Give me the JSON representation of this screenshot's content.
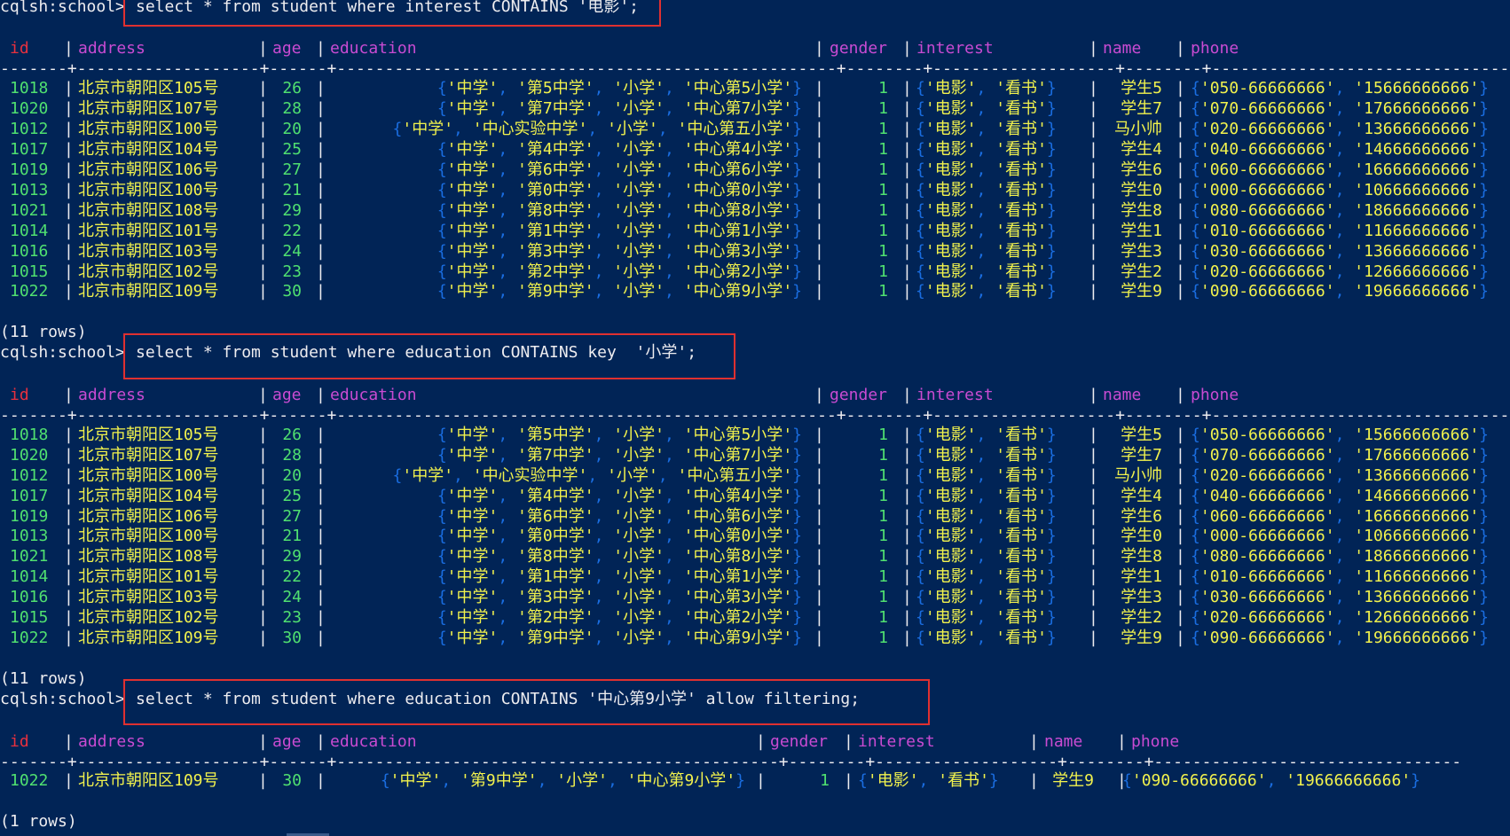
{
  "prompt": "cqlsh:school>",
  "blocks": [
    {
      "command": "select * from student where interest CONTAINS '电影';",
      "rows_summary": "(11 rows)",
      "columns": [
        "id",
        "address",
        "age",
        "education",
        "gender",
        "interest",
        "name",
        "phone"
      ],
      "rows": [
        {
          "id": "1018",
          "address": "北京市朝阳区105号",
          "age": "26",
          "education": [
            "中学",
            "第5中学",
            "小学",
            "中心第5小学"
          ],
          "gender": "1",
          "interest": [
            "电影",
            "看书"
          ],
          "name": "学生5",
          "phone": [
            "050-66666666",
            "15666666666"
          ]
        },
        {
          "id": "1020",
          "address": "北京市朝阳区107号",
          "age": "28",
          "education": [
            "中学",
            "第7中学",
            "小学",
            "中心第7小学"
          ],
          "gender": "1",
          "interest": [
            "电影",
            "看书"
          ],
          "name": "学生7",
          "phone": [
            "070-66666666",
            "17666666666"
          ]
        },
        {
          "id": "1012",
          "address": "北京市朝阳区100号",
          "age": "20",
          "education": [
            "中学",
            "中心实验中学",
            "小学",
            "中心第五小学"
          ],
          "gender": "1",
          "interest": [
            "电影",
            "看书"
          ],
          "name": "马小帅",
          "phone": [
            "020-66666666",
            "13666666666"
          ]
        },
        {
          "id": "1017",
          "address": "北京市朝阳区104号",
          "age": "25",
          "education": [
            "中学",
            "第4中学",
            "小学",
            "中心第4小学"
          ],
          "gender": "1",
          "interest": [
            "电影",
            "看书"
          ],
          "name": "学生4",
          "phone": [
            "040-66666666",
            "14666666666"
          ]
        },
        {
          "id": "1019",
          "address": "北京市朝阳区106号",
          "age": "27",
          "education": [
            "中学",
            "第6中学",
            "小学",
            "中心第6小学"
          ],
          "gender": "1",
          "interest": [
            "电影",
            "看书"
          ],
          "name": "学生6",
          "phone": [
            "060-66666666",
            "16666666666"
          ]
        },
        {
          "id": "1013",
          "address": "北京市朝阳区100号",
          "age": "21",
          "education": [
            "中学",
            "第0中学",
            "小学",
            "中心第0小学"
          ],
          "gender": "1",
          "interest": [
            "电影",
            "看书"
          ],
          "name": "学生0",
          "phone": [
            "000-66666666",
            "10666666666"
          ]
        },
        {
          "id": "1021",
          "address": "北京市朝阳区108号",
          "age": "29",
          "education": [
            "中学",
            "第8中学",
            "小学",
            "中心第8小学"
          ],
          "gender": "1",
          "interest": [
            "电影",
            "看书"
          ],
          "name": "学生8",
          "phone": [
            "080-66666666",
            "18666666666"
          ]
        },
        {
          "id": "1014",
          "address": "北京市朝阳区101号",
          "age": "22",
          "education": [
            "中学",
            "第1中学",
            "小学",
            "中心第1小学"
          ],
          "gender": "1",
          "interest": [
            "电影",
            "看书"
          ],
          "name": "学生1",
          "phone": [
            "010-66666666",
            "11666666666"
          ]
        },
        {
          "id": "1016",
          "address": "北京市朝阳区103号",
          "age": "24",
          "education": [
            "中学",
            "第3中学",
            "小学",
            "中心第3小学"
          ],
          "gender": "1",
          "interest": [
            "电影",
            "看书"
          ],
          "name": "学生3",
          "phone": [
            "030-66666666",
            "13666666666"
          ]
        },
        {
          "id": "1015",
          "address": "北京市朝阳区102号",
          "age": "23",
          "education": [
            "中学",
            "第2中学",
            "小学",
            "中心第2小学"
          ],
          "gender": "1",
          "interest": [
            "电影",
            "看书"
          ],
          "name": "学生2",
          "phone": [
            "020-66666666",
            "12666666666"
          ]
        },
        {
          "id": "1022",
          "address": "北京市朝阳区109号",
          "age": "30",
          "education": [
            "中学",
            "第9中学",
            "小学",
            "中心第9小学"
          ],
          "gender": "1",
          "interest": [
            "电影",
            "看书"
          ],
          "name": "学生9",
          "phone": [
            "090-66666666",
            "19666666666"
          ]
        }
      ]
    },
    {
      "command": "select * from student where education CONTAINS key  '小学';",
      "rows_summary": "(11 rows)",
      "columns": [
        "id",
        "address",
        "age",
        "education",
        "gender",
        "interest",
        "name",
        "phone"
      ],
      "rows": [
        {
          "id": "1018",
          "address": "北京市朝阳区105号",
          "age": "26",
          "education": [
            "中学",
            "第5中学",
            "小学",
            "中心第5小学"
          ],
          "gender": "1",
          "interest": [
            "电影",
            "看书"
          ],
          "name": "学生5",
          "phone": [
            "050-66666666",
            "15666666666"
          ]
        },
        {
          "id": "1020",
          "address": "北京市朝阳区107号",
          "age": "28",
          "education": [
            "中学",
            "第7中学",
            "小学",
            "中心第7小学"
          ],
          "gender": "1",
          "interest": [
            "电影",
            "看书"
          ],
          "name": "学生7",
          "phone": [
            "070-66666666",
            "17666666666"
          ]
        },
        {
          "id": "1012",
          "address": "北京市朝阳区100号",
          "age": "20",
          "education": [
            "中学",
            "中心实验中学",
            "小学",
            "中心第五小学"
          ],
          "gender": "1",
          "interest": [
            "电影",
            "看书"
          ],
          "name": "马小帅",
          "phone": [
            "020-66666666",
            "13666666666"
          ]
        },
        {
          "id": "1017",
          "address": "北京市朝阳区104号",
          "age": "25",
          "education": [
            "中学",
            "第4中学",
            "小学",
            "中心第4小学"
          ],
          "gender": "1",
          "interest": [
            "电影",
            "看书"
          ],
          "name": "学生4",
          "phone": [
            "040-66666666",
            "14666666666"
          ]
        },
        {
          "id": "1019",
          "address": "北京市朝阳区106号",
          "age": "27",
          "education": [
            "中学",
            "第6中学",
            "小学",
            "中心第6小学"
          ],
          "gender": "1",
          "interest": [
            "电影",
            "看书"
          ],
          "name": "学生6",
          "phone": [
            "060-66666666",
            "16666666666"
          ]
        },
        {
          "id": "1013",
          "address": "北京市朝阳区100号",
          "age": "21",
          "education": [
            "中学",
            "第0中学",
            "小学",
            "中心第0小学"
          ],
          "gender": "1",
          "interest": [
            "电影",
            "看书"
          ],
          "name": "学生0",
          "phone": [
            "000-66666666",
            "10666666666"
          ]
        },
        {
          "id": "1021",
          "address": "北京市朝阳区108号",
          "age": "29",
          "education": [
            "中学",
            "第8中学",
            "小学",
            "中心第8小学"
          ],
          "gender": "1",
          "interest": [
            "电影",
            "看书"
          ],
          "name": "学生8",
          "phone": [
            "080-66666666",
            "18666666666"
          ]
        },
        {
          "id": "1014",
          "address": "北京市朝阳区101号",
          "age": "22",
          "education": [
            "中学",
            "第1中学",
            "小学",
            "中心第1小学"
          ],
          "gender": "1",
          "interest": [
            "电影",
            "看书"
          ],
          "name": "学生1",
          "phone": [
            "010-66666666",
            "11666666666"
          ]
        },
        {
          "id": "1016",
          "address": "北京市朝阳区103号",
          "age": "24",
          "education": [
            "中学",
            "第3中学",
            "小学",
            "中心第3小学"
          ],
          "gender": "1",
          "interest": [
            "电影",
            "看书"
          ],
          "name": "学生3",
          "phone": [
            "030-66666666",
            "13666666666"
          ]
        },
        {
          "id": "1015",
          "address": "北京市朝阳区102号",
          "age": "23",
          "education": [
            "中学",
            "第2中学",
            "小学",
            "中心第2小学"
          ],
          "gender": "1",
          "interest": [
            "电影",
            "看书"
          ],
          "name": "学生2",
          "phone": [
            "020-66666666",
            "12666666666"
          ]
        },
        {
          "id": "1022",
          "address": "北京市朝阳区109号",
          "age": "30",
          "education": [
            "中学",
            "第9中学",
            "小学",
            "中心第9小学"
          ],
          "gender": "1",
          "interest": [
            "电影",
            "看书"
          ],
          "name": "学生9",
          "phone": [
            "090-66666666",
            "19666666666"
          ]
        }
      ]
    },
    {
      "command": "select * from student where education CONTAINS '中心第9小学' allow filtering;",
      "rows_summary": "(1 rows)",
      "columns": [
        "id",
        "address",
        "age",
        "education",
        "gender",
        "interest",
        "name",
        "phone"
      ],
      "rows": [
        {
          "id": "1022",
          "address": "北京市朝阳区109号",
          "age": "30",
          "education": [
            "中学",
            "第9中学",
            "小学",
            "中心第9小学"
          ],
          "gender": "1",
          "interest": [
            "电影",
            "看书"
          ],
          "name": "学生9",
          "phone": [
            "090-66666666",
            "19666666666"
          ]
        }
      ]
    }
  ],
  "colors": {
    "background": "#012456",
    "id_header": "#e8303e",
    "header": "#c94bd2",
    "number": "#50e070",
    "string": "#f2f24d",
    "list_punct": "#1a6de0",
    "highlight_box": "#e03030"
  }
}
